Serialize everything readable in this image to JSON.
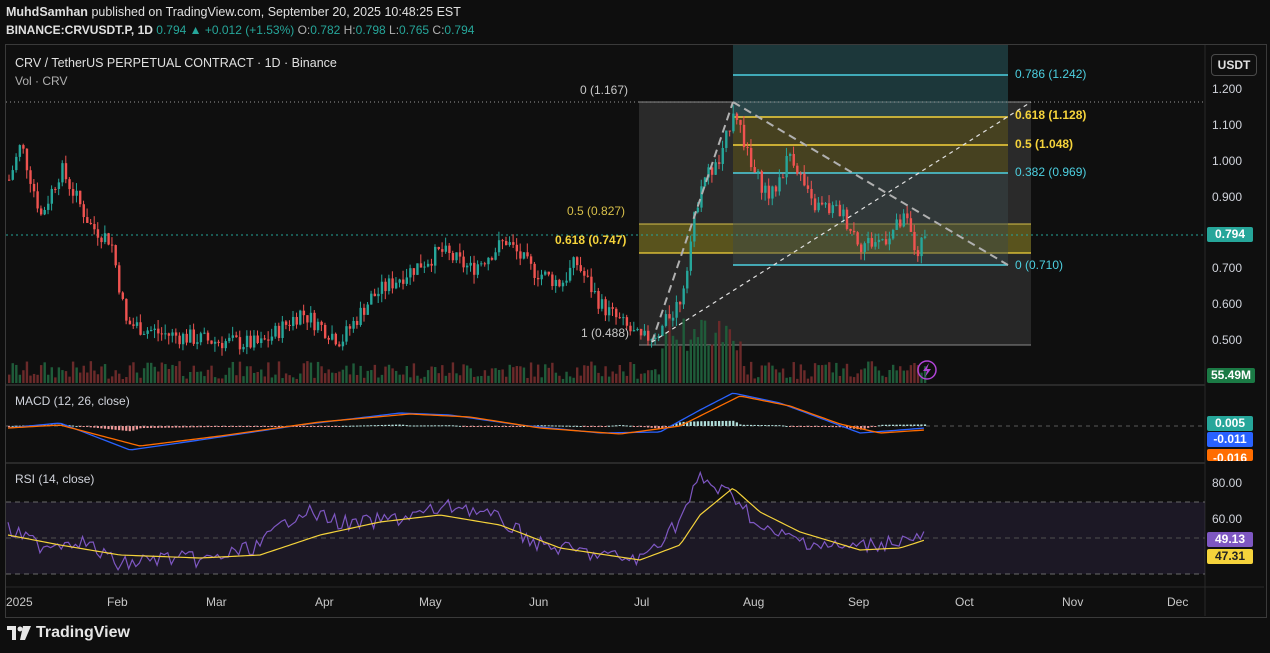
{
  "header": {
    "author": "MuhdSamhan",
    "published_text": "published on TradingView.com, September 20, 2025 10:48:25 EST",
    "symbol": "BINANCE:CRVUSDT.P, 1D",
    "price": "0.794",
    "change": "▲ +0.012 (+1.53%)",
    "o_label": "O:",
    "o_val": "0.782",
    "h_label": "H:",
    "h_val": "0.798",
    "l_label": "L:",
    "l_val": "0.765",
    "c_label": "C:",
    "c_val": "0.794"
  },
  "chart": {
    "title": "CRV / TetherUS PERPETUAL CONTRACT · 1D · Binance",
    "vol_label": "Vol · CRV",
    "currency_button": "USDT",
    "price_axis": [
      "1.200",
      "1.100",
      "1.000",
      "0.900",
      "0.800",
      "0.700",
      "0.600",
      "0.500"
    ],
    "macd_axis": [],
    "rsi_axis": [
      "80.00",
      "60.00"
    ],
    "x_axis": [
      "2025",
      "Feb",
      "Mar",
      "Apr",
      "May",
      "Jun",
      "Jul",
      "Aug",
      "Sep",
      "Oct",
      "Nov",
      "Dec"
    ],
    "tags": {
      "price": "0.794",
      "volume": "55.49M",
      "macd_hist": "0.005",
      "macd_line": "-0.011",
      "macd_signal": "-0.016",
      "rsi": "49.13",
      "rsi_ma": "47.31"
    },
    "indicators": {
      "macd_title": "MACD (12, 26, close)",
      "rsi_title": "RSI (14, close)"
    },
    "fib_left": [
      {
        "label": "0 (1.167)"
      },
      {
        "label": "0.5 (0.827)"
      },
      {
        "label": "0.618 (0.747)"
      },
      {
        "label": "1 (0.488)"
      }
    ],
    "fib_right": [
      {
        "label": "0.786 (1.242)"
      },
      {
        "label": "0.618 (1.128)"
      },
      {
        "label": "0.5 (1.048)"
      },
      {
        "label": "0.382 (0.969)"
      },
      {
        "label": "0 (0.710)"
      }
    ],
    "colors": {
      "up": "#26a69a",
      "down": "#ef5350",
      "teal": "#4dd0e1",
      "yellow": "#f5d33b",
      "macd": "#2962ff",
      "signal": "#ff6d00",
      "rsi": "#7e57c2",
      "rsi_ma": "#f5d33b"
    }
  },
  "footer": {
    "brand": "TradingView"
  }
}
